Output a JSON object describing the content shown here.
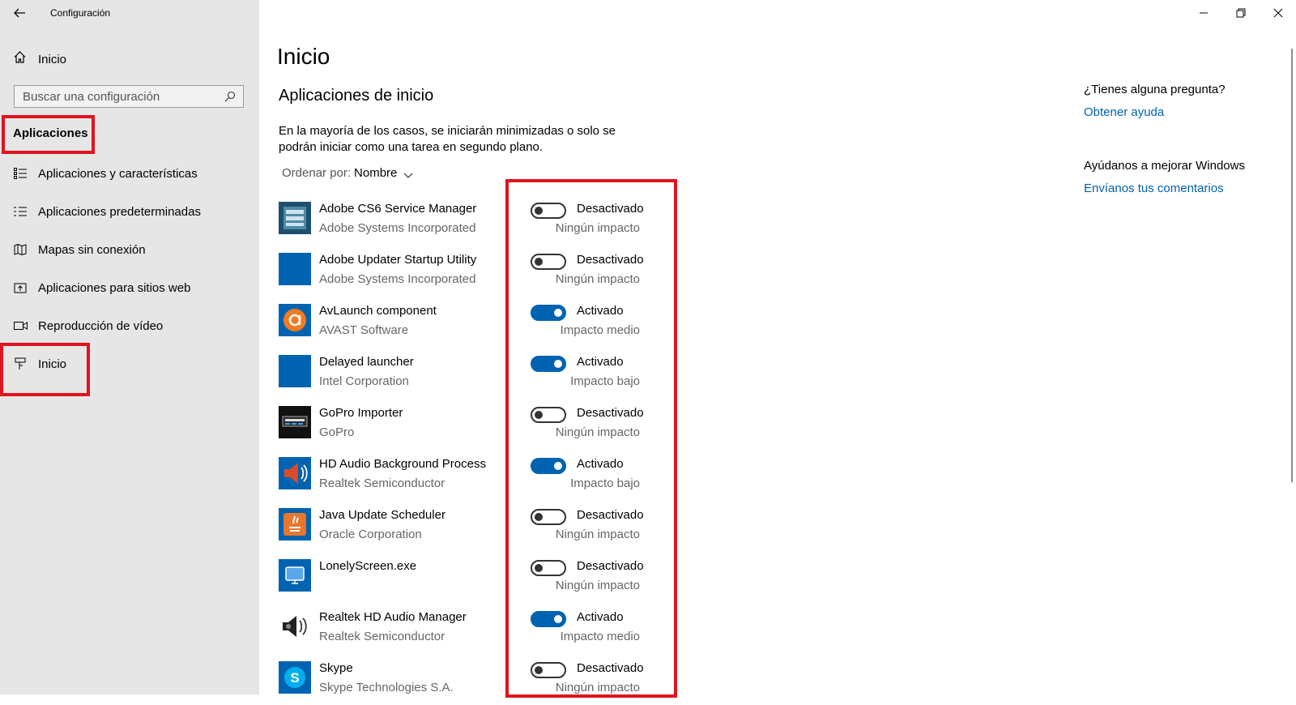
{
  "window": {
    "title": "Configuración",
    "icons": {
      "back": "back-arrow-icon",
      "minimize": "minimize-icon",
      "restore": "restore-icon",
      "close": "close-icon"
    }
  },
  "sidebar": {
    "home_label": "Inicio",
    "search_placeholder": "Buscar una configuración",
    "section_title": "Aplicaciones",
    "items": [
      {
        "label": "Aplicaciones y características",
        "icon": "apps-features-icon"
      },
      {
        "label": "Aplicaciones predeterminadas",
        "icon": "default-apps-icon"
      },
      {
        "label": "Mapas sin conexión",
        "icon": "offline-maps-icon"
      },
      {
        "label": "Aplicaciones para sitios web",
        "icon": "apps-websites-icon"
      },
      {
        "label": "Reproducción de vídeo",
        "icon": "video-playback-icon"
      },
      {
        "label": "Inicio",
        "icon": "startup-icon"
      }
    ]
  },
  "main": {
    "title": "Inicio",
    "section_heading": "Aplicaciones de inicio",
    "description": "En la mayoría de los casos, se iniciarán minimizadas o solo se podrán iniciar como una tarea en segundo plano.",
    "sort_prefix": "Ordenar por:",
    "sort_value": "Nombre",
    "apps": [
      {
        "name": "Adobe CS6 Service Manager",
        "publisher": "Adobe Systems Incorporated",
        "enabled": false,
        "state": "Desactivado",
        "impact": "Ningún impacto",
        "icon": "adobe-cs6-icon"
      },
      {
        "name": "Adobe Updater Startup Utility",
        "publisher": "Adobe Systems Incorporated",
        "enabled": false,
        "state": "Desactivado",
        "impact": "Ningún impacto",
        "icon": "adobe-updater-icon"
      },
      {
        "name": "AvLaunch component",
        "publisher": "AVAST Software",
        "enabled": true,
        "state": "Activado",
        "impact": "Impacto medio",
        "icon": "avast-icon"
      },
      {
        "name": "Delayed launcher",
        "publisher": "Intel Corporation",
        "enabled": true,
        "state": "Activado",
        "impact": "Impacto bajo",
        "icon": "intel-launcher-icon"
      },
      {
        "name": "GoPro Importer",
        "publisher": "GoPro",
        "enabled": false,
        "state": "Desactivado",
        "impact": "Ningún impacto",
        "icon": "gopro-icon"
      },
      {
        "name": "HD Audio Background Process",
        "publisher": "Realtek Semiconductor",
        "enabled": true,
        "state": "Activado",
        "impact": "Impacto bajo",
        "icon": "speaker-icon"
      },
      {
        "name": "Java Update Scheduler",
        "publisher": "Oracle Corporation",
        "enabled": false,
        "state": "Desactivado",
        "impact": "Ningún impacto",
        "icon": "java-icon"
      },
      {
        "name": "LonelyScreen.exe",
        "publisher": "",
        "enabled": false,
        "state": "Desactivado",
        "impact": "Ningún impacto",
        "icon": "lonelyscreen-icon"
      },
      {
        "name": "Realtek HD Audio Manager",
        "publisher": "Realtek Semiconductor",
        "enabled": true,
        "state": "Activado",
        "impact": "Impacto medio",
        "icon": "realtek-speaker-icon"
      },
      {
        "name": "Skype",
        "publisher": "Skype Technologies S.A.",
        "enabled": false,
        "state": "Desactivado",
        "impact": "Ningún impacto",
        "icon": "skype-icon"
      }
    ]
  },
  "aside": {
    "question": "¿Tienes alguna pregunta?",
    "help_link": "Obtener ayuda",
    "improve_heading": "Ayúdanos a mejorar Windows",
    "feedback_link": "Envíanos tus comentarios"
  },
  "colors": {
    "accent": "#0063b1",
    "highlight": "#e0141e",
    "sidebar_bg": "#e6e6e6"
  }
}
